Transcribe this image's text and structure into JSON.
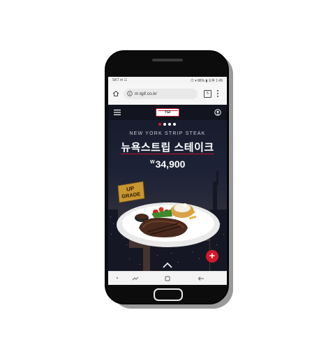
{
  "status_bar": {
    "left_text": "SKT ✉ ☷",
    "right_text": "⊙ ▾ 88% ▮ 오후 1:49"
  },
  "browser": {
    "url": "m.tgif.co.kr",
    "tab_count": "5"
  },
  "site": {
    "logo_text": "TGI FRIDAYS",
    "carousel_dots": 4,
    "active_dot": 0,
    "subtitle_en": "NEW YORK STRIP STEAK",
    "title_ko": "뉴욕스트립 스테이크",
    "price_symbol": "W",
    "price_value": "34,900",
    "badge_line1": "UP",
    "badge_line2": "GRADE",
    "fab_label": "+"
  },
  "colors": {
    "accent_red": "#d21a2c",
    "badge_gold": "#c9962f"
  },
  "icons": {
    "home": "home-icon",
    "info": "info-icon",
    "tabs": "tabs-icon",
    "overflow": "more-vertical-icon",
    "hamburger": "hamburger-menu-icon",
    "location": "location-icon",
    "scroll_up": "chevron-up-icon",
    "recent_apps": "recent-apps-icon",
    "android_home": "android-home-icon",
    "back": "back-icon"
  }
}
